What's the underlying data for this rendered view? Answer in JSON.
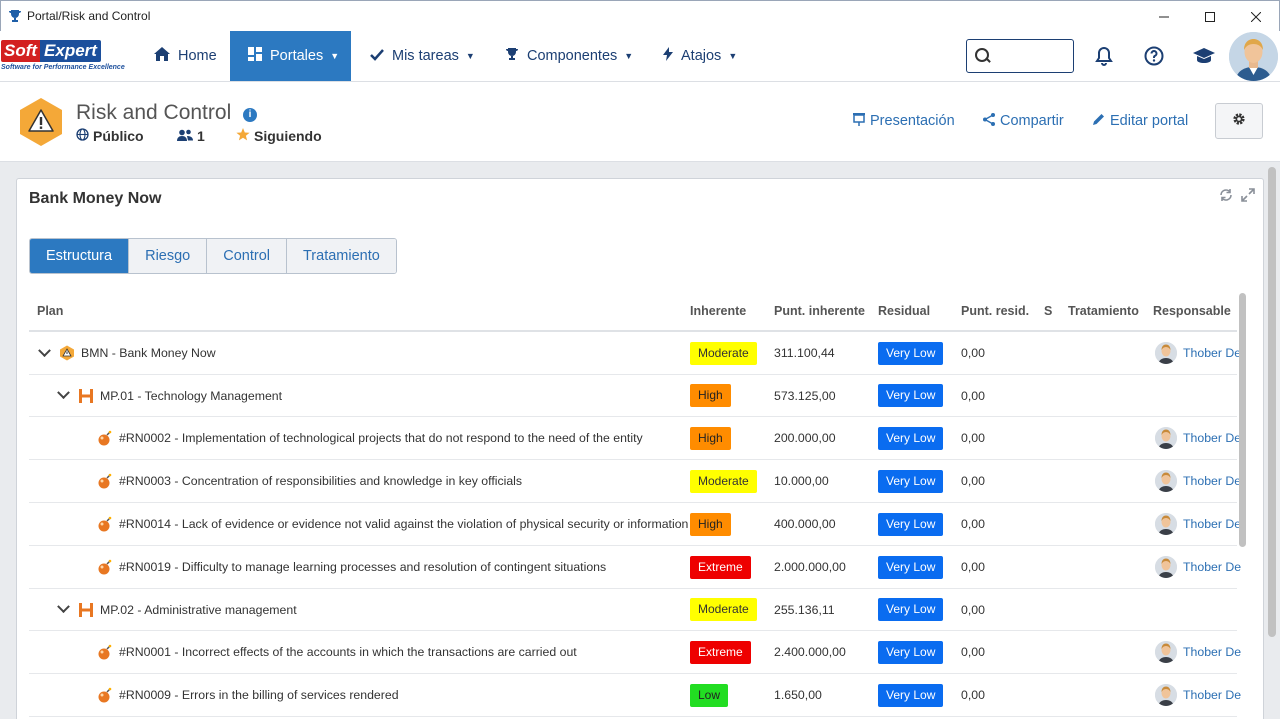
{
  "window": {
    "title": "Portal/Risk and Control"
  },
  "nav": {
    "logo_soft": "Soft",
    "logo_expert": "Expert",
    "logo_tagline": "Software for Performance Excellence",
    "home": "Home",
    "portales": "Portales",
    "mis_tareas": "Mis tareas",
    "componentes": "Componentes",
    "atajos": "Atajos",
    "search_placeholder": ""
  },
  "portal": {
    "title": "Risk and Control",
    "visibility": "Público",
    "members": "1",
    "following": "Siguiendo",
    "presentacion": "Presentación",
    "compartir": "Compartir",
    "editar": "Editar portal"
  },
  "widget": {
    "title": "Bank Money Now",
    "tabs": [
      "Estructura",
      "Riesgo",
      "Control",
      "Tratamiento"
    ]
  },
  "table": {
    "headers": {
      "plan": "Plan",
      "inherente": "Inherente",
      "punt_inherente": "Punt. inherente",
      "residual": "Residual",
      "punt_resid": "Punt. resid.",
      "s": "S",
      "tratamiento": "Tratamiento",
      "responsable": "Responsable"
    },
    "rows": [
      {
        "plan": "BMN - Bank Money Now",
        "inherente": "Moderate",
        "punt_inherente": "311.100,44",
        "residual": "Very Low",
        "punt_resid": "0,00",
        "responsable": "Thober De"
      },
      {
        "plan": "MP.01 - Technology Management",
        "inherente": "High",
        "punt_inherente": "573.125,00",
        "residual": "Very Low",
        "punt_resid": "0,00",
        "responsable": ""
      },
      {
        "plan": "#RN0002 - Implementation of technological projects that do not respond to the need of the entity",
        "inherente": "High",
        "punt_inherente": "200.000,00",
        "residual": "Very Low",
        "punt_resid": "0,00",
        "responsable": "Thober De"
      },
      {
        "plan": "#RN0003 - Concentration of responsibilities and knowledge in key officials",
        "inherente": "Moderate",
        "punt_inherente": "10.000,00",
        "residual": "Very Low",
        "punt_resid": "0,00",
        "responsable": "Thober De"
      },
      {
        "plan": "#RN0014 - Lack of evidence or evidence not valid against the violation of physical security or information",
        "inherente": "High",
        "punt_inherente": "400.000,00",
        "residual": "Very Low",
        "punt_resid": "0,00",
        "responsable": "Thober De"
      },
      {
        "plan": "#RN0019 - Difficulty to manage learning processes and resolution of contingent situations",
        "inherente": "Extreme",
        "punt_inherente": "2.000.000,00",
        "residual": "Very Low",
        "punt_resid": "0,00",
        "responsable": "Thober De"
      },
      {
        "plan": "MP.02 - Administrative management",
        "inherente": "Moderate",
        "punt_inherente": "255.136,11",
        "residual": "Very Low",
        "punt_resid": "0,00",
        "responsable": ""
      },
      {
        "plan": "#RN0001 - Incorrect effects of the accounts in which the transactions are carried out",
        "inherente": "Extreme",
        "punt_inherente": "2.400.000,00",
        "residual": "Very Low",
        "punt_resid": "0,00",
        "responsable": "Thober De"
      },
      {
        "plan": "#RN0009 - Errors in the billing of services rendered",
        "inherente": "Low",
        "punt_inherente": "1.650,00",
        "residual": "Very Low",
        "punt_resid": "0,00",
        "responsable": "Thober De"
      }
    ]
  },
  "colors": {
    "accent": "#2c79c1",
    "moderate": "#ffff00",
    "high": "#ff8c00",
    "extreme": "#ee0000",
    "low": "#22dd22",
    "very_low": "#0a6cf0"
  }
}
